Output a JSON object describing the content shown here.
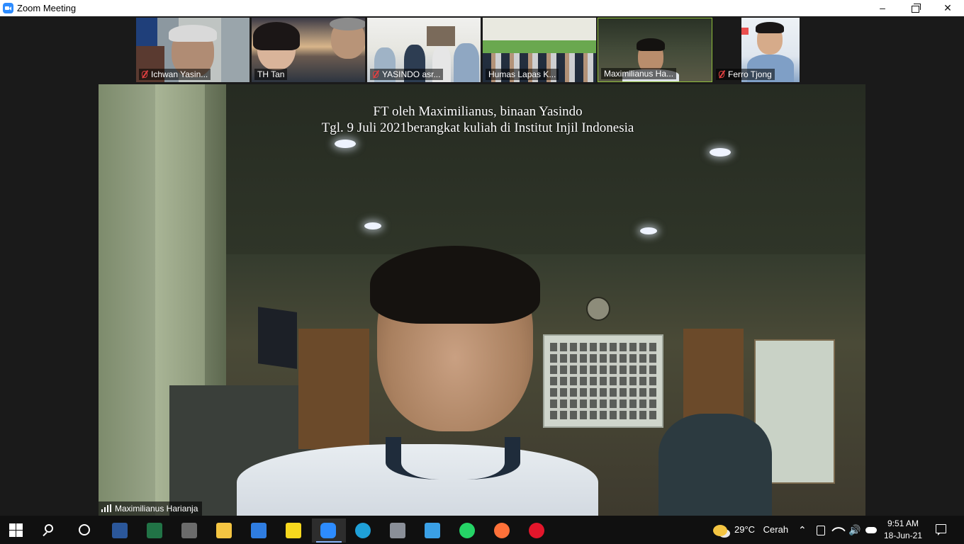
{
  "window": {
    "title": "Zoom Meeting",
    "minimize_label": "–",
    "close_label": "✕"
  },
  "gallery": {
    "participants": [
      {
        "name": "Ichwan Yasin...",
        "muted": true,
        "active": false
      },
      {
        "name": "TH Tan",
        "muted": false,
        "active": false
      },
      {
        "name": "YASINDO asr...",
        "muted": true,
        "active": false
      },
      {
        "name": "Humas Lapas K...",
        "muted": false,
        "active": false
      },
      {
        "name": "Maximilianus Ha...",
        "muted": false,
        "active": true
      },
      {
        "name": "Ferro Tjong",
        "muted": true,
        "active": false
      }
    ]
  },
  "main_video": {
    "caption_line1": "FT oleh Maximilianus, binaan Yasindo",
    "caption_line2": "Tgl. 9 Juli 2021berangkat kuliah di Institut Injil Indonesia",
    "speaker_name": "Maximilianus Harianja"
  },
  "taskbar": {
    "apps": [
      {
        "icon": "word-icon",
        "color": "#2b579a"
      },
      {
        "icon": "excel-icon",
        "color": "#217346"
      },
      {
        "icon": "calculator-icon",
        "color": "#6b6b6b"
      },
      {
        "icon": "file-explorer-icon",
        "color": "#f4c542"
      },
      {
        "icon": "calendar-icon",
        "color": "#2f7de1"
      },
      {
        "icon": "sticky-notes-icon",
        "color": "#f7d81e"
      },
      {
        "icon": "zoom-icon",
        "color": "#2d8cff"
      },
      {
        "icon": "edge-icon",
        "color": "#1fa0d8"
      },
      {
        "icon": "camera-icon",
        "color": "#8a8f98"
      },
      {
        "icon": "sync-app-icon",
        "color": "#3aa0e6"
      },
      {
        "icon": "whatsapp-icon",
        "color": "#25d366"
      },
      {
        "icon": "firefox-icon",
        "color": "#ff7139"
      },
      {
        "icon": "opera-icon",
        "color": "#e3162b"
      }
    ],
    "weather": {
      "temperature": "29°C",
      "condition": "Cerah"
    },
    "clock": {
      "time": "9:51 AM",
      "date": "18-Jun-21"
    }
  }
}
